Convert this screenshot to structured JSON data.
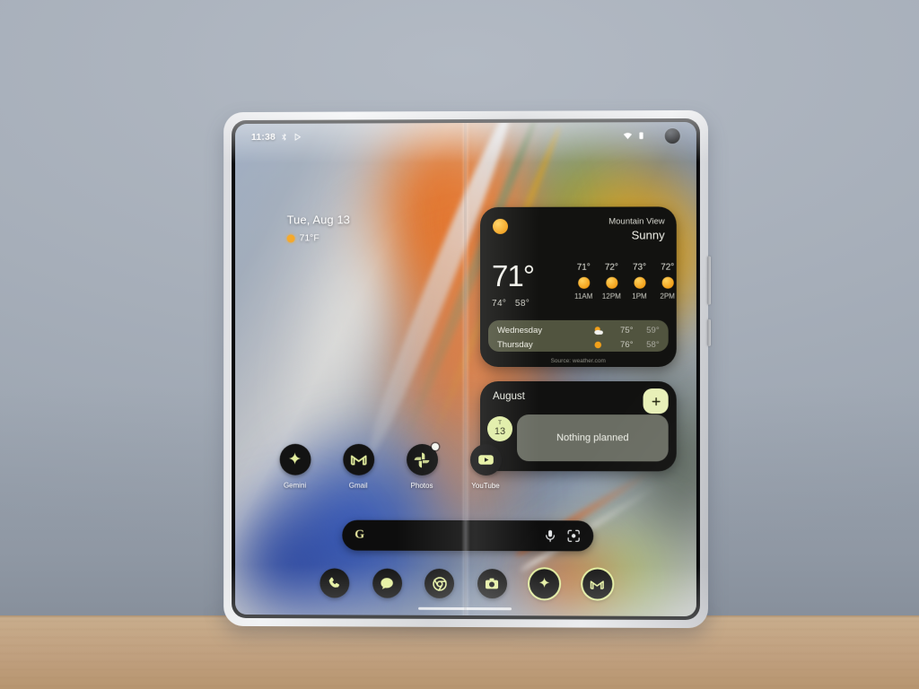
{
  "scene": {
    "description": "Foldable phone open on a wooden table against a grey wall",
    "wall_color": "#a9b1bc",
    "table_color": "#c6a988",
    "device_frame_color": "#d9dade"
  },
  "status_bar": {
    "time": "11:38",
    "left_icons": [
      "bluetooth-icon",
      "cast-icon"
    ],
    "right_icons": [
      "wifi-icon",
      "battery-icon"
    ],
    "camera": "punch-hole-camera"
  },
  "at_a_glance": {
    "date": "Tue, Aug 13",
    "temperature": "71°F",
    "icon": "sun-icon"
  },
  "weather_widget": {
    "condition_icon": "sun-icon",
    "city": "Mountain View",
    "condition": "Sunny",
    "current_temp": "71°",
    "high": "74°",
    "low": "58°",
    "hourly": [
      {
        "temp": "71°",
        "time": "11AM",
        "icon": "sun-icon"
      },
      {
        "temp": "72°",
        "time": "12PM",
        "icon": "sun-icon"
      },
      {
        "temp": "73°",
        "time": "1PM",
        "icon": "sun-icon"
      },
      {
        "temp": "72°",
        "time": "2PM",
        "icon": "sun-icon"
      }
    ],
    "daily": [
      {
        "day": "Wednesday",
        "icon": "partly-cloudy-icon",
        "high": "75°",
        "low": "59°"
      },
      {
        "day": "Thursday",
        "icon": "sun-icon",
        "high": "76°",
        "low": "58°"
      }
    ],
    "source": "Source: weather.com",
    "bg_color": "#121210",
    "days_bg_color": "#51543f"
  },
  "calendar_widget": {
    "month": "August",
    "add_label": "+",
    "date_chip_day": "T",
    "date_chip_number": "13",
    "empty_state": "Nothing planned",
    "chip_color": "#e0eda6",
    "empty_bg": "#6a6d63"
  },
  "apps": [
    {
      "name": "Gemini",
      "icon": "gemini-sparkle-icon",
      "badge": false
    },
    {
      "name": "Gmail",
      "icon": "gmail-m-icon",
      "badge": false
    },
    {
      "name": "Photos",
      "icon": "google-photos-pinwheel-icon",
      "badge": true
    },
    {
      "name": "YouTube",
      "icon": "youtube-play-icon",
      "badge": false
    }
  ],
  "search_bar": {
    "logo": "google-g-icon",
    "placeholder": "",
    "value": "",
    "mic_icon": "microphone-icon",
    "lens_icon": "google-lens-icon"
  },
  "dock": [
    {
      "name": "Phone",
      "icon": "phone-handset-icon",
      "ring": false
    },
    {
      "name": "Messages",
      "icon": "messages-bubble-icon",
      "ring": false
    },
    {
      "name": "Chrome",
      "icon": "chrome-icon",
      "ring": false
    },
    {
      "name": "Camera",
      "icon": "camera-icon",
      "ring": false
    },
    {
      "name": "Gemini",
      "icon": "gemini-sparkle-icon",
      "ring": true
    },
    {
      "name": "Gmail",
      "icon": "gmail-m-icon",
      "ring": true
    }
  ],
  "nav": {
    "gesture_pill": "home-gesture-pill"
  },
  "accent_colors": {
    "lime": "#e0eda6",
    "sun_yellow": "#f2a01a",
    "widget_dark": "#121210",
    "text_light": "#efefe8"
  }
}
